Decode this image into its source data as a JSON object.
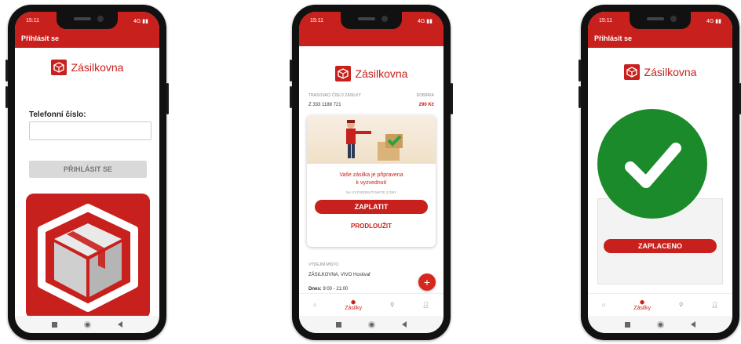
{
  "status": {
    "time": "15:11",
    "signal": "4G ▮▮"
  },
  "brand": {
    "name": "Zásilkovna",
    "color": "#c8201c"
  },
  "phone1": {
    "title": "Přihlásit se",
    "phone_label": "Telefonní číslo:",
    "phone_value": "",
    "login_button": "PŘIHLÁSIT SE"
  },
  "phone2": {
    "tracking_label": "TRASOVACÍ ČÍSLO ZÁSILKY",
    "cod_label": "DOBÍRKA",
    "tracking_number": "Z 333 1188 721",
    "cod_amount": "290 Kč",
    "message_line1": "Vaše zásilka je připravena",
    "message_line2": "k vyzvednutí",
    "pickup_hint": "NA VYZVEDNUTÍ MÁTE 3 DNY",
    "pay_button": "ZAPLATIT",
    "extend_button": "PRODLOUŽIT",
    "place_label": "VÝDEJNÍ MÍSTO",
    "place_name": "ZÁSILKOVNA, VIVO Hostivař",
    "hours_prefix": "Dnes:",
    "hours_value": "9:00 - 21:00",
    "fab": "+",
    "nav_active": "Zásilky"
  },
  "phone3": {
    "title": "Přihlásit se",
    "paid_button": "ZAPLACENO",
    "nav_active": "Zásilky"
  }
}
